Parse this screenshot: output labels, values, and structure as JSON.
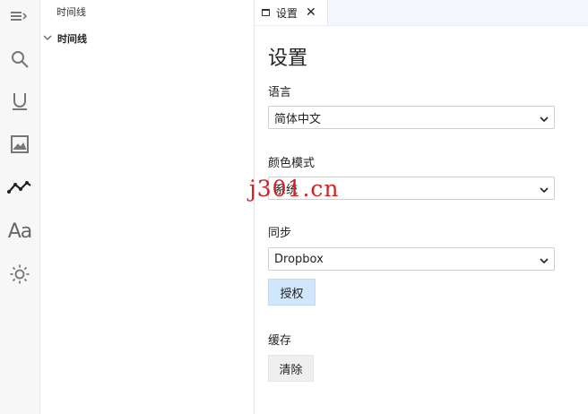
{
  "activity_bar": {
    "items": [
      {
        "icon": "outline-menu-icon"
      },
      {
        "icon": "search-icon"
      },
      {
        "icon": "underline-icon"
      },
      {
        "icon": "image-icon"
      },
      {
        "icon": "timeline-chart-icon",
        "active": true
      },
      {
        "icon": "font-icon",
        "text": "Aa"
      },
      {
        "icon": "theme-sun-icon"
      }
    ]
  },
  "explorer": {
    "title": "时间线",
    "tree": [
      {
        "label": "时间线",
        "expanded": true
      }
    ]
  },
  "tabs": [
    {
      "label": "设置",
      "close": "✕"
    }
  ],
  "settings": {
    "title": "设置",
    "language": {
      "label": "语言",
      "value": "简体中文"
    },
    "color_mode": {
      "label": "颜色模式",
      "value": "系统"
    },
    "sync": {
      "label": "同步",
      "value": "Dropbox",
      "authorize_label": "授权"
    },
    "cache": {
      "label": "缓存",
      "clear_label": "清除"
    }
  },
  "watermark": "j301.cn",
  "colors": {
    "primary_button": "#cfe6fb",
    "watermark": "#d42020"
  }
}
